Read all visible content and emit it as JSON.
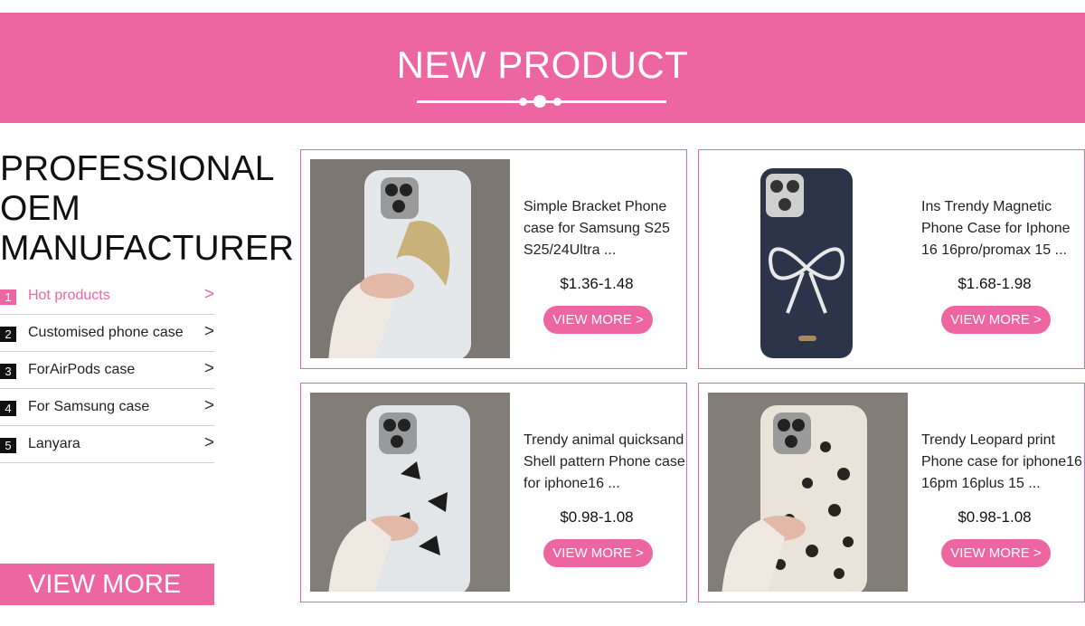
{
  "header": {
    "title": "NEW PRODUCT"
  },
  "sidebar": {
    "title_lines": [
      "PROFESSIONAL",
      "OEM",
      "MANUFACTURER"
    ],
    "items": [
      {
        "num": "1",
        "label": "Hot products",
        "arrow": ">"
      },
      {
        "num": "2",
        "label": "Customised phone case",
        "arrow": ">"
      },
      {
        "num": "3",
        "label": "ForAirPods case",
        "arrow": ">"
      },
      {
        "num": "4",
        "label": "For Samsung case",
        "arrow": ">"
      },
      {
        "num": "5",
        "label": "Lanyara",
        "arrow": ">"
      }
    ],
    "cta": "VIEW MORE"
  },
  "products": [
    {
      "title": "Simple Bracket Phone case for Samsung S25 S25/24Ultra ...",
      "price": "$1.36-1.48",
      "button": "VIEW MORE >"
    },
    {
      "title": "Ins Trendy Magnetic Phone Case for Iphone 16 16pro/promax 15 ...",
      "price": "$1.68-1.98",
      "button": "VIEW MORE >"
    },
    {
      "title": "Trendy animal quicksand Shell pattern Phone case for iphone16 ...",
      "price": "$0.98-1.08",
      "button": "VIEW MORE >"
    },
    {
      "title": "Trendy Leopard print Phone case for iphone16 16pm 16plus 15 ...",
      "price": "$0.98-1.08",
      "button": "VIEW MORE >"
    }
  ],
  "colors": {
    "accent": "#ee66a1",
    "text": "#111111"
  },
  "icons": {
    "chevron": "chevron-right-icon",
    "ornament": "divider-dots"
  }
}
